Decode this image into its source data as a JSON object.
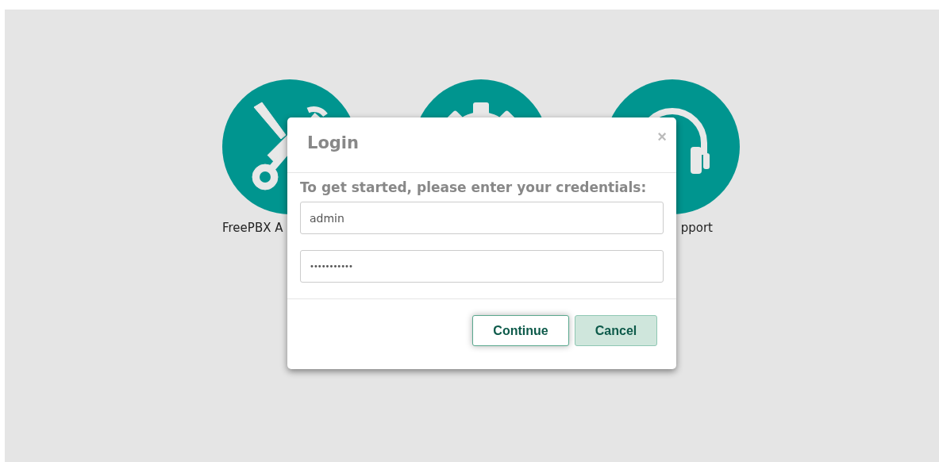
{
  "tiles": [
    {
      "kind": "tools",
      "label": "FreePBX A"
    },
    {
      "kind": "gear"
    },
    {
      "kind": "headset",
      "label": "pport"
    }
  ],
  "dialog": {
    "title": "Login",
    "close": "×",
    "prompt": "To get started, please enter your credentials:",
    "fields": [
      {
        "kind": "text",
        "value": "admin"
      },
      {
        "kind": "password",
        "value": "•••••••••••"
      }
    ],
    "buttons": [
      {
        "label": "Continue",
        "kind": "primary"
      },
      {
        "label": "Cancel",
        "kind": "secondary"
      }
    ]
  }
}
